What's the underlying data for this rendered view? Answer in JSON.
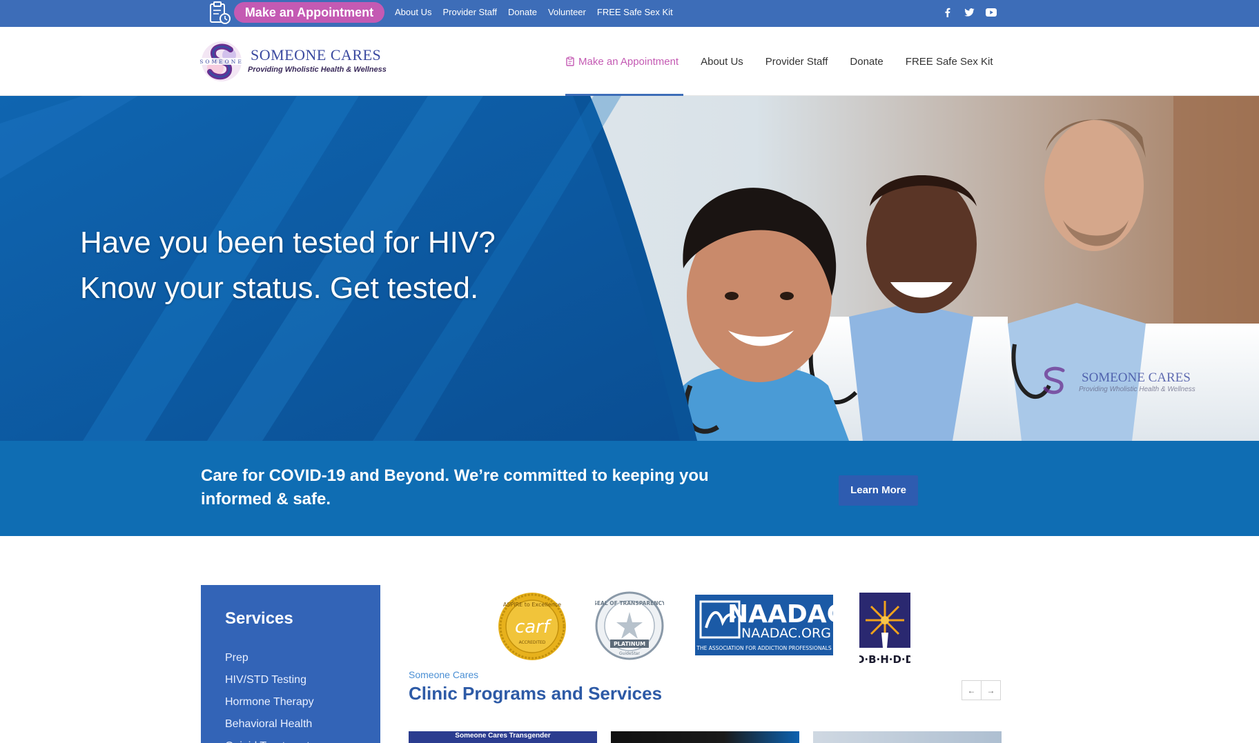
{
  "topbar": {
    "appointment_label": "Make an Appointment",
    "links": [
      "About Us",
      "Provider Staff",
      "Donate",
      "Volunteer",
      "FREE Safe Sex Kit"
    ],
    "social_icons": [
      "facebook-icon",
      "twitter-icon",
      "youtube-icon"
    ],
    "bar_color": "#3d6db8",
    "pill_color": "#c45ab3"
  },
  "header": {
    "logo_name": "SOMEONE CARES",
    "logo_tagline": "Providing Wholistic Health & Wellness",
    "nav": [
      "Make an Appointment",
      "About Us",
      "Provider Staff",
      "Donate",
      "FREE Safe Sex Kit"
    ],
    "active_nav": "Make an Appointment"
  },
  "hero": {
    "line1": "Have you been tested for HIV?",
    "line2": "Know your status. Get tested.",
    "watermark_name": "SOMEONE CARES",
    "watermark_tagline": "Providing Wholistic Health & Wellness"
  },
  "covid": {
    "text": "Care for COVID-19 and Beyond. We’re committed to keeping you informed & safe.",
    "button": "Learn More"
  },
  "services": {
    "title": "Services",
    "items": [
      "Prep",
      "HIV/STD Testing",
      "Hormone Therapy",
      "Behavioral Health",
      "Opioid Treatment"
    ]
  },
  "accreditations": {
    "carf": {
      "ring": "ASPIRE to Excellence",
      "name": "carf",
      "sub": "ACCREDITED"
    },
    "guidestar": {
      "ring": "SEAL OF TRANSPARENCY",
      "level": "PLATINUM",
      "org": "GuideStar"
    },
    "naadac": {
      "name": "NAADAC",
      "url": "NAADAC.ORG",
      "tagline": "THE ASSOCIATION FOR ADDICTION PROFESSIONALS"
    },
    "dbhdd": {
      "name": "D·B·H·D·D"
    }
  },
  "programs": {
    "eyebrow": "Someone Cares",
    "title": "Clinic Programs and Services",
    "prev_icon": "arrow-left-icon",
    "next_icon": "arrow-right-icon",
    "card1_caption": "Someone Cares Transgender"
  }
}
